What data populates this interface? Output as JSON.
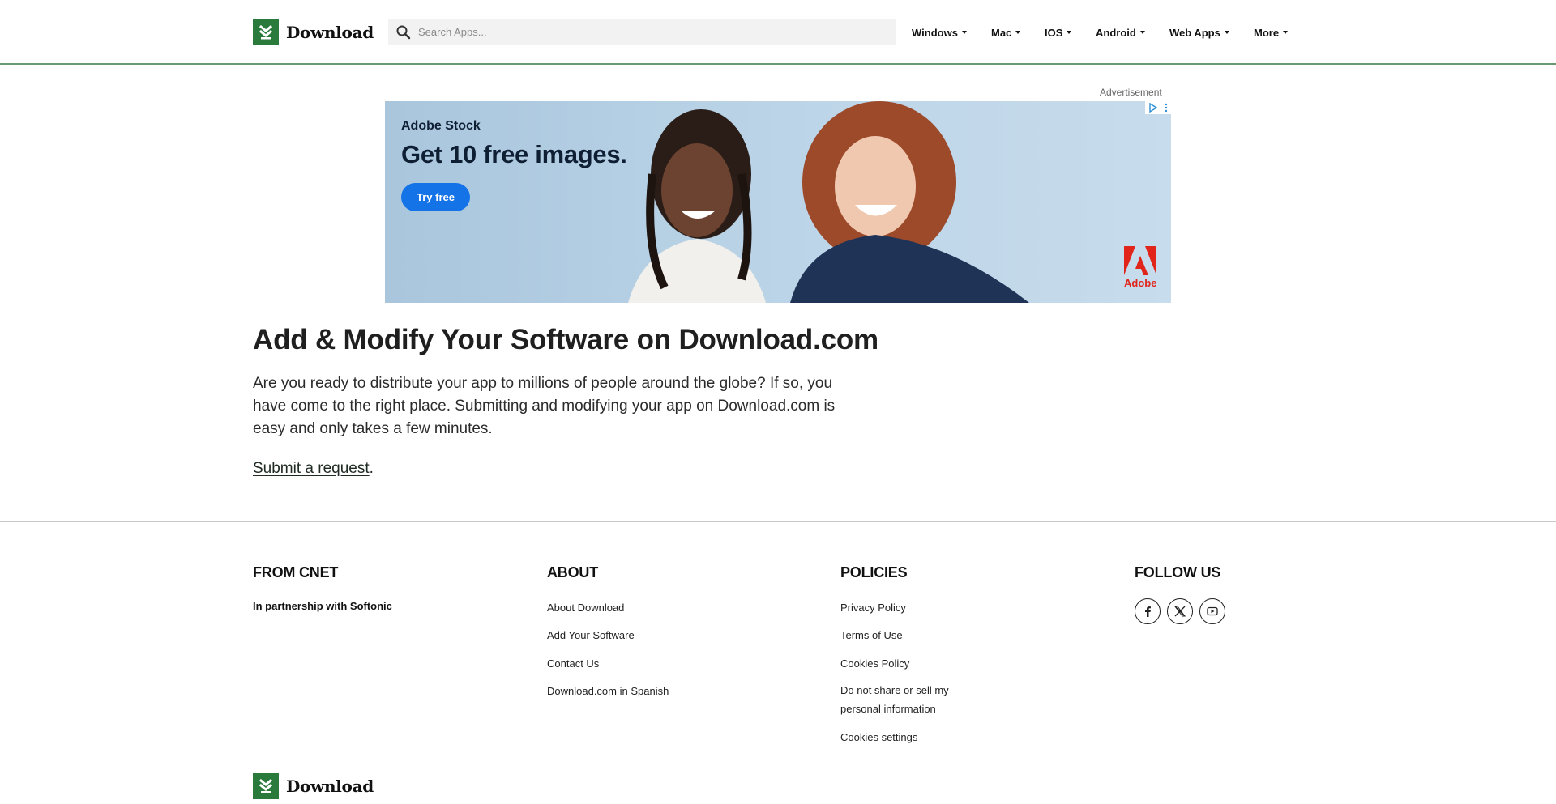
{
  "header": {
    "logo_text": "Download",
    "search_placeholder": "Search Apps...",
    "nav": [
      "Windows",
      "Mac",
      "IOS",
      "Android",
      "Web Apps",
      "More"
    ]
  },
  "ad": {
    "label": "Advertisement",
    "brand": "Adobe Stock",
    "headline": "Get 10 free images.",
    "cta": "Try free",
    "logo_word": "Adobe"
  },
  "main": {
    "title": "Add & Modify Your Software on Download.com",
    "intro": "Are you ready to distribute your app to millions of people around the globe? If so, you have come to the right place. Submitting and modifying your app on Download.com is easy and only takes a few minutes.",
    "submit_link": "Submit a request",
    "submit_suffix": "."
  },
  "footer": {
    "from_cnet": {
      "title": "FROM CNET",
      "subtitle": "In partnership with Softonic"
    },
    "about": {
      "title": "ABOUT",
      "links": [
        "About Download",
        "Add Your Software",
        "Contact Us",
        "Download.com in Spanish"
      ]
    },
    "policies": {
      "title": "POLICIES",
      "links": [
        "Privacy Policy",
        "Terms of Use",
        "Cookies Policy",
        "Do not share or sell my personal information",
        "Cookies settings"
      ]
    },
    "follow": {
      "title": "FOLLOW US",
      "icons": [
        "facebook-icon",
        "x-icon",
        "youtube-icon"
      ]
    },
    "logo_text": "Download"
  },
  "colors": {
    "brand_green": "#2a7a3b",
    "header_rule": "#6a9a72",
    "ad_button": "#1473e6",
    "adobe_red": "#e1251b"
  }
}
